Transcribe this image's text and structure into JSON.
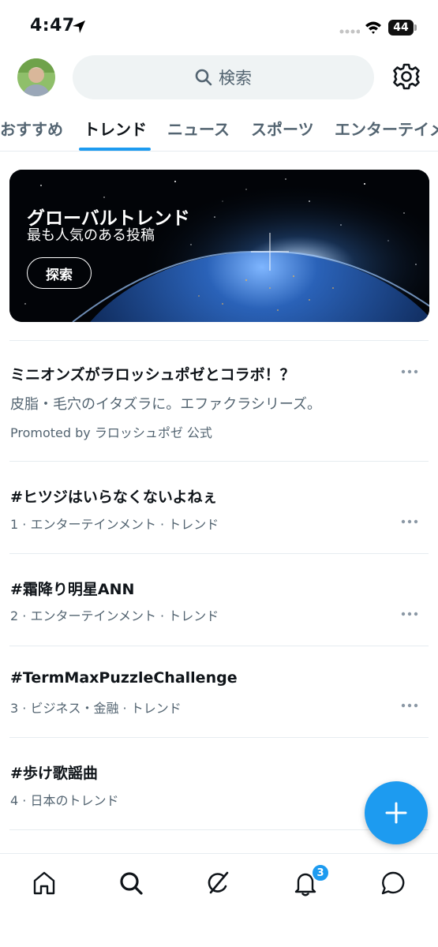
{
  "status_bar": {
    "time": "4:47",
    "battery": "44"
  },
  "search": {
    "placeholder": "検索"
  },
  "tabs": [
    {
      "label": "おすすめ",
      "active": false
    },
    {
      "label": "トレンド",
      "active": true
    },
    {
      "label": "ニュース",
      "active": false
    },
    {
      "label": "スポーツ",
      "active": false
    },
    {
      "label": "エンターテイメ",
      "active": false
    }
  ],
  "banner": {
    "title": "グローバルトレンド",
    "subtitle": "最も人気のある投稿",
    "button_label": "探索"
  },
  "promoted": {
    "title": "ミニオンズがラロッシュポゼとコラボ！？",
    "description": "皮脂・毛穴のイタズラに。エファクラシリーズ。",
    "meta": "Promoted by ラロッシュポゼ 公式"
  },
  "trends": [
    {
      "title": "#ヒツジはいらなくないよねぇ",
      "meta": "1 · エンターテインメント · トレンド"
    },
    {
      "title": "#霜降り明星ANN",
      "meta": "2 · エンターテインメント · トレンド"
    },
    {
      "title": "#TermMaxPuzzleChallenge",
      "meta": "3 · ビジネス・金融 · トレンド"
    },
    {
      "title": "#歩け歌謡曲",
      "meta": "4 · 日本のトレンド"
    }
  ],
  "notifications": {
    "count": "3"
  },
  "colors": {
    "accent": "#1d9bf0",
    "secondary_text": "#536471",
    "search_bg": "#eff3f4"
  },
  "icons": {
    "status": [
      "location-arrow-icon",
      "cellular-signal-icon",
      "wifi-icon",
      "battery-icon"
    ],
    "header": [
      "avatar",
      "search-icon",
      "gear-icon"
    ],
    "nav": [
      "home-icon",
      "search-icon",
      "grok-icon",
      "bell-icon",
      "messages-icon"
    ],
    "fab": "plus-icon"
  }
}
